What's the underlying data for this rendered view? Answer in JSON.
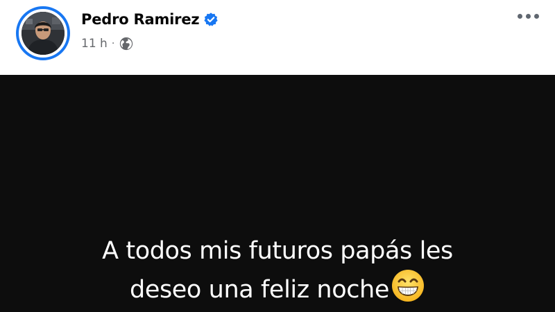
{
  "post": {
    "author": {
      "name": "Pedro Ramirez",
      "verified": true,
      "avatar_icon": "profile-photo"
    },
    "meta": {
      "time": "11 h",
      "separator": "·",
      "audience_icon": "globe-icon"
    },
    "more_icon": "more-horizontal-icon",
    "content": {
      "line1": "A todos mis futuros papás les",
      "line2": "deseo una feliz noche",
      "emoji_icon": "grinning-face-with-smiling-eyes-icon",
      "background": "#0d0d0d",
      "text_color": "#ffffff"
    }
  },
  "colors": {
    "accent": "#1877f2",
    "secondary_text": "#65676b",
    "primary_text": "#050505"
  }
}
